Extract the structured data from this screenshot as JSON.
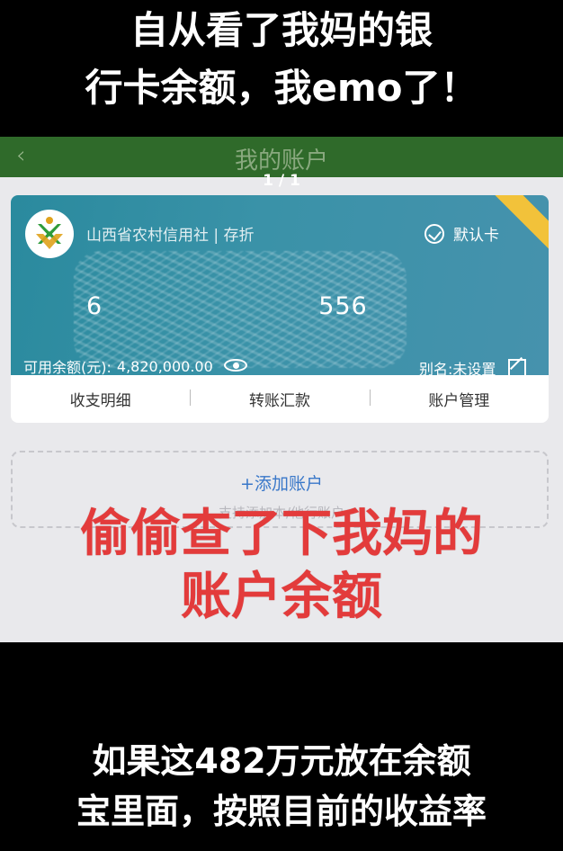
{
  "caption_top": {
    "line1": "自从看了我妈的银",
    "line2": "行卡余额，我emo了！"
  },
  "header": {
    "back_icon": "chevron-left-icon",
    "title": "我的账户"
  },
  "page_counter": "1 / 1",
  "card": {
    "bank_name": "山西省农村信用社 | 存折",
    "default_label": "默认卡",
    "number_fragment_start": "6",
    "number_fragment_end": "556",
    "balance_label": "可用余额(元):",
    "balance_value": "4,820,000.00",
    "alias": "别名:未设置",
    "actions": [
      "收支明细",
      "转账汇款",
      "账户管理"
    ],
    "colors": {
      "card_bg": "#3a92a8",
      "ribbon": "#f2c23a"
    }
  },
  "add_account": {
    "label": "+添加账户",
    "sub": "支持添加本/他行账户"
  },
  "overlay": {
    "line1": "偷偷查了下我妈的",
    "line2": "账户余额",
    "color": "#e33b3b"
  },
  "caption_bottom": {
    "line1": "如果这482万元放在余额",
    "line2": "宝里面，按照目前的收益率"
  }
}
